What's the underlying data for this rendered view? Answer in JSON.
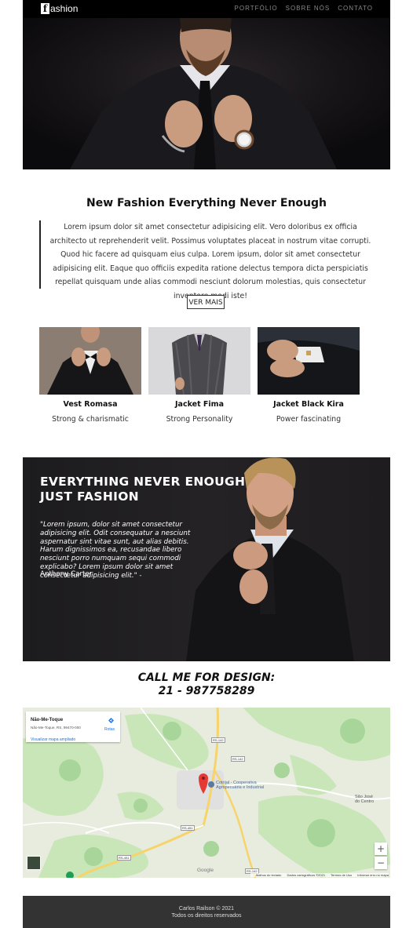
{
  "nav": {
    "logo_letter": "f",
    "logo_rest": "ashion",
    "menu": [
      "PORTFÓLIO",
      "SOBRE NÓS",
      "CONTATO"
    ]
  },
  "hero": {
    "image": "man-adjusting-tie-dark-suit"
  },
  "section": {
    "title": "New Fashion Everything Never Enough",
    "intro": "Lorem ipsum dolor sit amet consectetur adipisicing elit. Vero doloribus ex officia architecto ut reprehenderit velit. Possimus voluptates placeat in nostrum vitae corrupti. Quod hic facere ad quisquam eius culpa. Lorem ipsum, dolor sit amet consectetur adipisicing elit. Eaque quo officiis expedita ratione delectus tempora dicta perspiciatis repellat quisquam unde alias commodi nesciunt dolorum molestias, quis consectetur inventore modi iste!",
    "button": "VER MAIS"
  },
  "products": [
    {
      "name": "Vest Romasa",
      "desc": "Strong & charismatic"
    },
    {
      "name": "Jacket Fima",
      "desc": "Strong Personality"
    },
    {
      "name": "Jacket Black Kira",
      "desc": "Power fascinating"
    }
  ],
  "quote": {
    "title_line1": "EVERYTHING NEVER ENOUGH",
    "title_line2": "JUST FASHION",
    "text": "\"Lorem ipsum, dolor sit amet consectetur adipisicing elit. Odit consequatur a nesciunt aspernatur sint vitae sunt, aut alias debitis. Harum dignissimos ea, recusandae libero nesciunt porro numquam sequi commodi explicabo? Lorem ipsum dolor sit amet consectetur adipisicing elit.\" -",
    "author": "Anthony Carter"
  },
  "call": {
    "line1": "CALL ME FOR DESIGN:",
    "line2": "21 - 987758289"
  },
  "map": {
    "place_title": "Não-Me-Toque",
    "place_address": "Não-Me-Toque, RS, 99470-000",
    "larger_map": "Visualizar mapa ampliado",
    "directions": "Rotas",
    "poi_line1": "Cotrijal - Cooperativa",
    "poi_line2": "Agropecuária e Industrial",
    "town_line1": "São José",
    "town_line2": "do Centro",
    "roads": [
      "RS-142",
      "RS-142",
      "RS-451",
      "RS-451",
      "RS-142"
    ],
    "zoom_in": "+",
    "zoom_out": "−",
    "google": "Google",
    "footer": [
      "Atalhos do teclado",
      "Dados cartográficos ©2021",
      "Termos de Uso",
      "Informar erro no mapa"
    ]
  },
  "footer": {
    "line1": "Carlos Railson © 2021",
    "line2": "Todos os direitos reservados"
  },
  "colors": {
    "nav_bg": "#000000",
    "footer_bg": "#333333",
    "map_pin": "#e53935"
  }
}
